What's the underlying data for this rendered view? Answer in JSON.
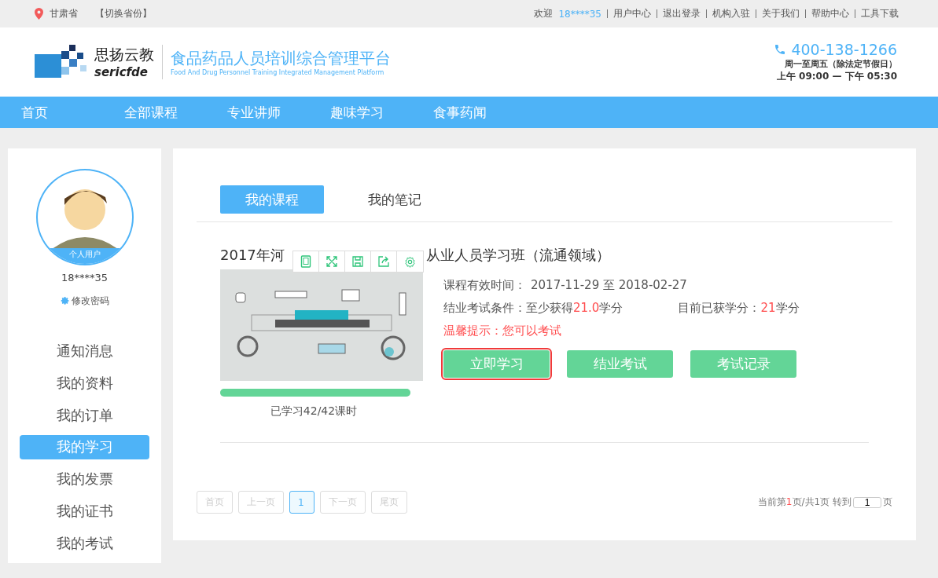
{
  "topbar": {
    "location": "甘肃省",
    "switch": "【切换省份】",
    "welcome": "欢迎",
    "user": "18****35",
    "links": [
      "用户中心",
      "退出登录",
      "机构入驻",
      "关于我们",
      "帮助中心",
      "工具下载"
    ]
  },
  "header": {
    "brand_cn": "思扬云教",
    "brand_en": "sericfde",
    "platform_cn": "食品药品人员培训综合管理平台",
    "platform_en": "Food And Drug Personnel Training Integrated Management Platform",
    "phone": "400-138-1266",
    "hours_1": "周一至周五（除法定节假日）",
    "hours_2": "上午 09:00 — 下午 05:30"
  },
  "nav": [
    "首页",
    "全部课程",
    "专业讲师",
    "趣味学习",
    "食事药闻"
  ],
  "profile": {
    "badge": "个人用户",
    "user": "18****35",
    "change_password": "修改密码"
  },
  "sidebar": {
    "items": [
      {
        "label": "通知消息",
        "selected": false
      },
      {
        "label": "我的资料",
        "selected": false
      },
      {
        "label": "我的订单",
        "selected": false
      },
      {
        "label": "我的学习",
        "selected": true
      },
      {
        "label": "我的发票",
        "selected": false
      },
      {
        "label": "我的证书",
        "selected": false
      },
      {
        "label": "我的考试",
        "selected": false
      }
    ]
  },
  "tabs": [
    {
      "label": "我的课程",
      "selected": true
    },
    {
      "label": "我的笔记",
      "selected": false
    }
  ],
  "course": {
    "title_start": "2017年河",
    "title_end": "从业人员学习班（流通领域）",
    "progress": {
      "level": 1
    },
    "progress_text": "已学习42/42课时",
    "valid_label": "课程有效时间：",
    "valid_value": "2017-11-29 至 2018-02-27",
    "condition": "结业考试条件：至少获得**21.0**学分",
    "earned": "目前已获学分：**21**学分",
    "hint": "温馨提示：您可以考试",
    "buttons": [
      {
        "label": "立即学习",
        "highlighted": true
      },
      {
        "label": "结业考试",
        "highlighted": false
      },
      {
        "label": "考试记录",
        "highlighted": false
      }
    ]
  },
  "pagination": {
    "pages": [
      {
        "label": "首页",
        "selected": false
      },
      {
        "label": "上一页",
        "selected": false
      },
      {
        "label": "1",
        "selected": true
      },
      {
        "label": "下一页",
        "selected": false
      },
      {
        "label": "尾页",
        "selected": false
      }
    ],
    "summary": "当前第**1**页/共1页 转到",
    "goto": "1",
    "suffix": "页"
  }
}
